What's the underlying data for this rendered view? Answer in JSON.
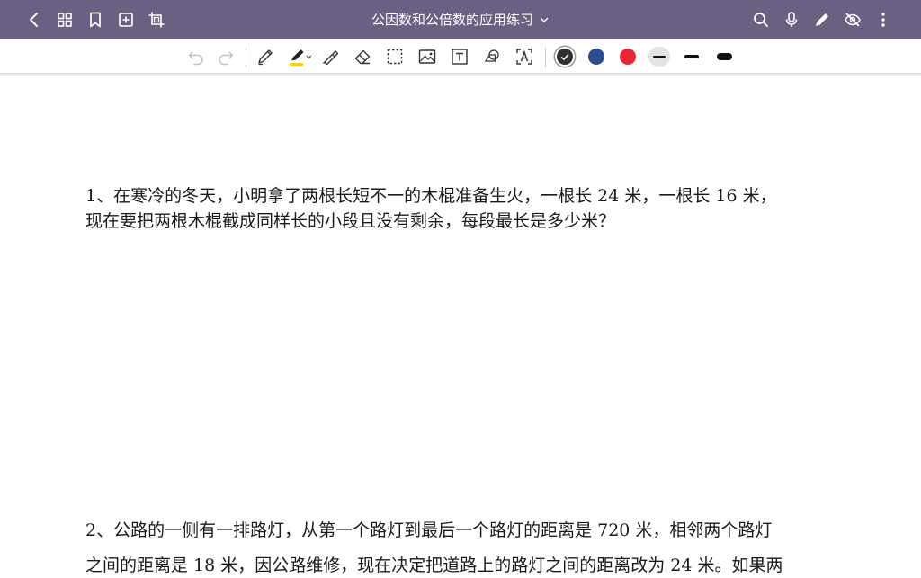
{
  "titlebar": {
    "title": "公因数和公倍数的应用练习",
    "background_color": "#6b5f82",
    "left_icons": [
      "back-icon",
      "grid-icon",
      "bookmark-icon",
      "add-page-icon",
      "crop-icon"
    ],
    "right_icons": [
      "search-icon",
      "microphone-icon",
      "pencil-icon",
      "eye-off-icon",
      "more-icon"
    ]
  },
  "toolbar": {
    "tools": [
      "undo-icon",
      "redo-icon",
      "pen-icon",
      "highlighter-icon",
      "eraser-brush-icon",
      "eraser-icon",
      "lasso-select-icon",
      "image-icon",
      "text-box-icon",
      "shape-icon",
      "text-recognition-icon"
    ],
    "colors": [
      "#2f2f2f",
      "#2e4d8f",
      "#e8283a"
    ],
    "selected_color": "#2f2f2f",
    "highlighter_color": "#f2d21b",
    "stroke_sizes": [
      "thin",
      "medium",
      "thick"
    ],
    "selected_stroke": "thin"
  },
  "content": {
    "q1_line1": "1、在寒冷的冬天，小明拿了两根长短不一的木棍准备生火，一根长 24 米，一根长 16 米，",
    "q1_line2": "现在要把两根木棍截成同样长的小段且没有剩余，每段最长是多少米？",
    "q2_line1": "2、公路的一侧有一排路灯，从第一个路灯到最后一个路灯的距离是 720 米，相邻两个路灯",
    "q2_line2": "之间的距离是 18 米，因公路维修，现在决定把道路上的路灯之间的距离改为 24 米。如果两"
  }
}
